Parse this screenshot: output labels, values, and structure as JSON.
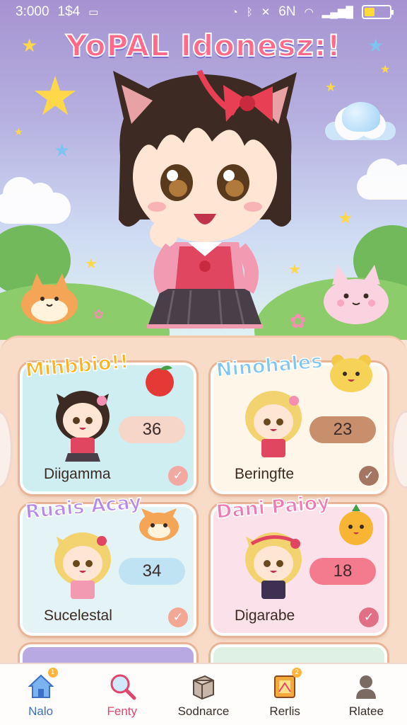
{
  "status_bar": {
    "time": "3:000",
    "extra": "1$4",
    "network": "6N",
    "battery_level": 0.4,
    "colors": {
      "text": "#ffffff",
      "battery": "#ffdb39"
    }
  },
  "app": {
    "title": "YoPAL Idonesz:!"
  },
  "cards": [
    {
      "title": "Mihbbio!!",
      "name": "Diigamma",
      "score": "36",
      "bg": "#cfeef2",
      "title_color": "#ffb21e",
      "score_bg": "#f6d6c8",
      "check_color": "#f2a9a1"
    },
    {
      "title": "Ninohales",
      "name": "Beringfte",
      "score": "23",
      "bg": "#fff6ea",
      "title_color": "#7fc6f0",
      "score_bg": "#c78f6b",
      "check_color": "#a57561"
    },
    {
      "title": "Ruais Acay",
      "name": "Sucelestal",
      "score": "34",
      "bg": "#e4f3f5",
      "title_color": "#b689e8",
      "score_bg": "#bfe3f3",
      "check_color": "#f3a795"
    },
    {
      "title": "Dani Paioy",
      "name": "Digarabe",
      "score": "18",
      "bg": "#fbe1ea",
      "title_color": "#f07bb4",
      "score_bg": "#f47b8e",
      "check_color": "#e16f86"
    }
  ],
  "bottom_nav": [
    {
      "label": "Nalo",
      "icon": "home-icon",
      "color": "#3b70c4",
      "badge": "1"
    },
    {
      "label": "Fenty",
      "icon": "search-icon",
      "color": "#e0456c",
      "badge": ""
    },
    {
      "label": "Sodnarce",
      "icon": "box-icon",
      "color": "#3a2e2a",
      "badge": ""
    },
    {
      "label": "Rerlis",
      "icon": "puzzle-icon",
      "color": "#3a2e2a",
      "badge": "2"
    },
    {
      "label": "Rlatee",
      "icon": "profile-icon",
      "color": "#3a2e2a",
      "badge": ""
    }
  ]
}
